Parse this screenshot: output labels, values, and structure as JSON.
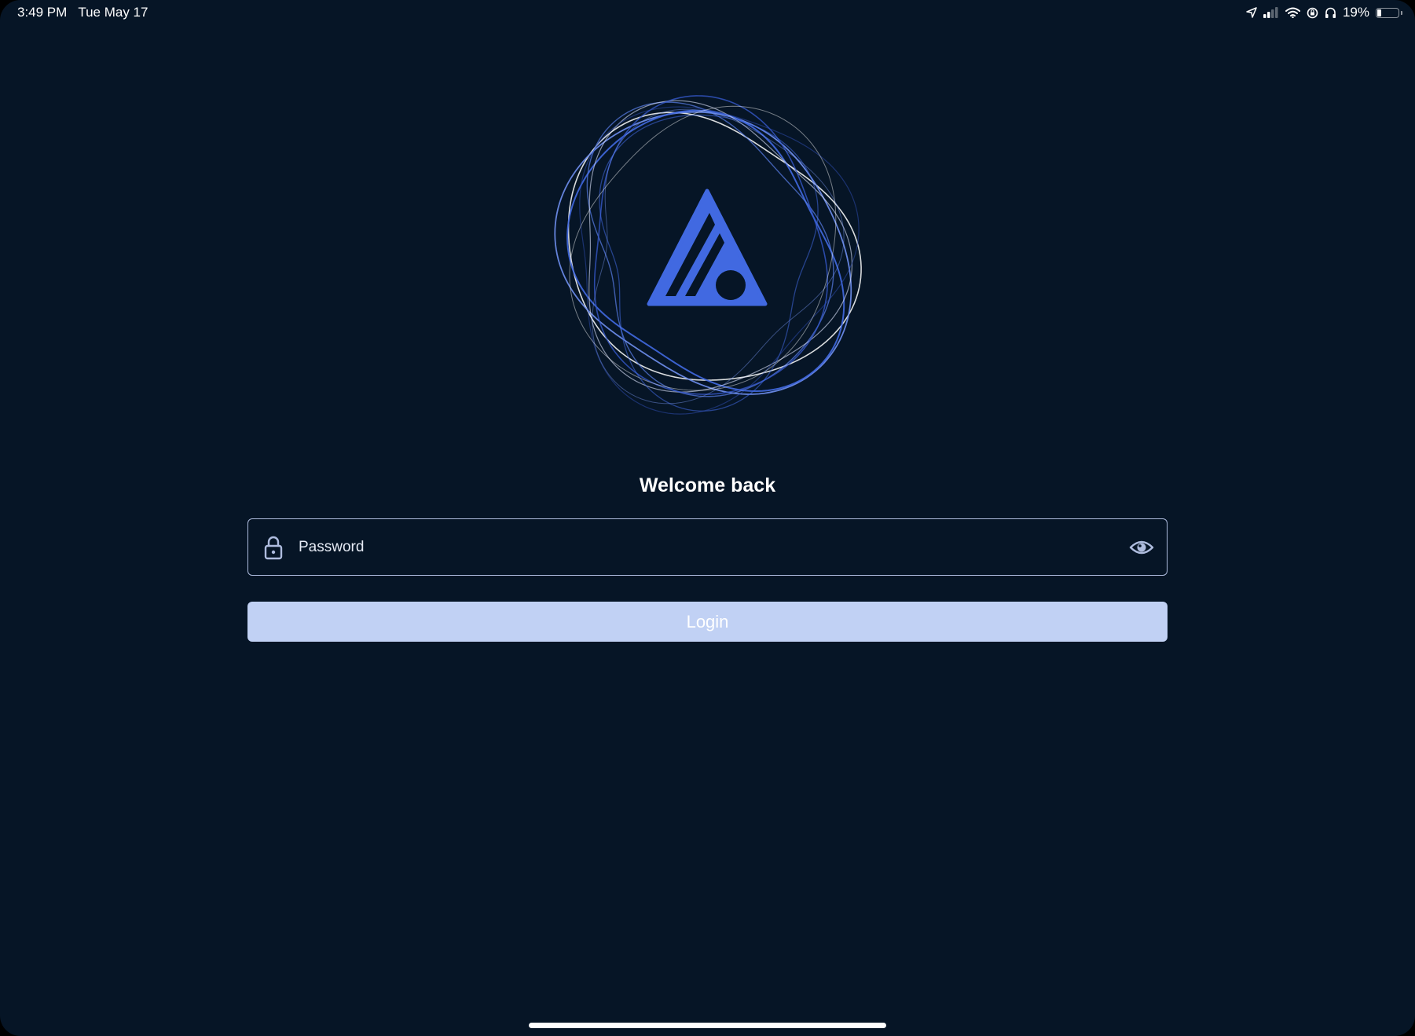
{
  "status_bar": {
    "time": "3:49 PM",
    "date": "Tue May 17",
    "battery_percent": "19%",
    "battery_level": 0.19,
    "icons": [
      "location-icon",
      "cellular-signal-icon",
      "wifi-icon",
      "screen-lock-rotation-icon",
      "headphones-icon",
      "battery-icon"
    ]
  },
  "login": {
    "welcome_text": "Welcome back",
    "password_placeholder": "Password",
    "password_value": "",
    "login_label": "Login"
  },
  "colors": {
    "background": "#061526",
    "accent": "#4169e1",
    "button_disabled": "#c1d1f4",
    "field_border": "#aebcde"
  }
}
